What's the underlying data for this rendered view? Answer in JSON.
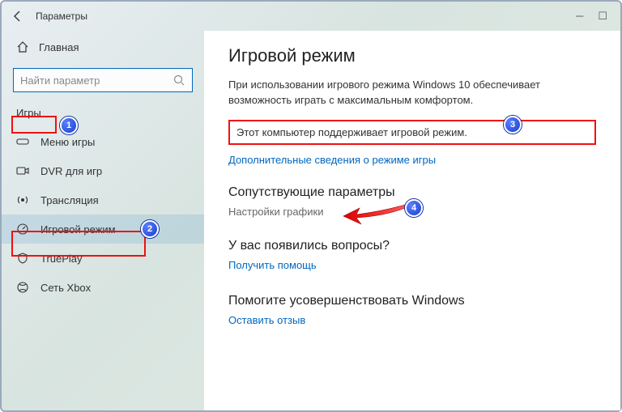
{
  "titlebar": {
    "title": "Параметры"
  },
  "sidebar": {
    "home": "Главная",
    "search_placeholder": "Найти параметр",
    "category": "Игры",
    "items": [
      {
        "label": "Меню игры"
      },
      {
        "label": "DVR для игр"
      },
      {
        "label": "Трансляция"
      },
      {
        "label": "Игровой режим"
      },
      {
        "label": "TruePlay"
      },
      {
        "label": "Сеть Xbox"
      }
    ]
  },
  "main": {
    "heading": "Игровой режим",
    "description": "При использовании игрового режима Windows 10 обеспечивает возможность играть с максимальным комфортом.",
    "support_text": "Этот компьютер поддерживает игровой режим.",
    "more_info_link": "Дополнительные сведения о режиме игры",
    "related_heading": "Сопутствующие параметры",
    "graphics_link": "Настройки графики",
    "questions_heading": "У вас появились вопросы?",
    "help_link": "Получить помощь",
    "improve_heading": "Помогите усовершенствовать Windows",
    "feedback_link": "Оставить отзыв"
  },
  "badges": {
    "b1": "1",
    "b2": "2",
    "b3": "3",
    "b4": "4"
  }
}
